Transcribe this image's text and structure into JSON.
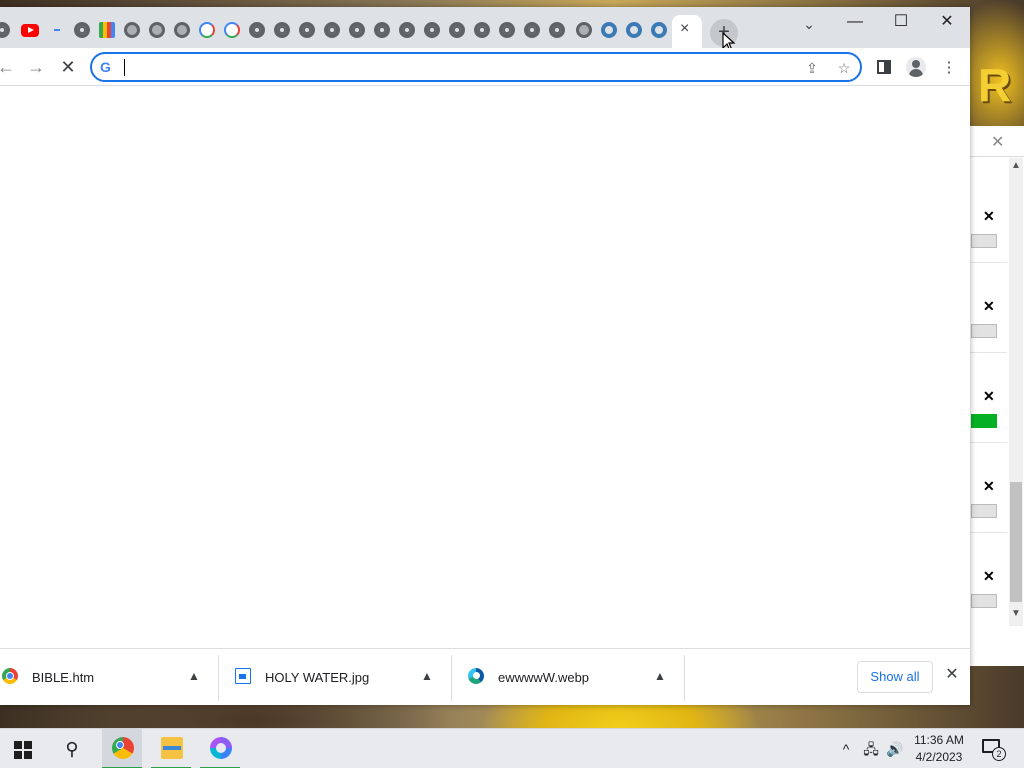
{
  "browser": {
    "new_tab_symbol": "+",
    "active_tab_close": "×",
    "window_controls": {
      "tab_search": "⌄",
      "minimize": "—",
      "maximize": "☐",
      "close": "✕"
    },
    "toolbar": {
      "back": "←",
      "forward": "→",
      "stop": "✕"
    },
    "omnibox": {
      "value": "",
      "placeholder": "",
      "search_engine_icon": "G"
    },
    "toolbar_icons": [
      "share-icon",
      "bookmark-star-icon",
      "side-panel-icon",
      "profile-icon",
      "menu-icon"
    ],
    "tab_favicons": [
      "chrome-icon",
      "youtube-icon",
      "google-dash-icon",
      "chrome-icon",
      "google-apps-grid-icon",
      "globe-icon",
      "globe-icon",
      "globe-icon",
      "google-icon",
      "google-icon",
      "chrome-icon",
      "chrome-icon",
      "chrome-icon",
      "chrome-icon",
      "chrome-icon",
      "chrome-icon",
      "chrome-icon",
      "chrome-icon",
      "chrome-icon",
      "chrome-icon",
      "chrome-icon",
      "chrome-icon",
      "globe-icon",
      "blue-ring-icon",
      "blue-ring-icon",
      "blue-ring-icon"
    ]
  },
  "downloads": {
    "items": [
      {
        "name": "BIBLE.htm",
        "icon": "chrome-file-icon"
      },
      {
        "name": "HOLY WATER.jpg",
        "icon": "image-file-icon"
      },
      {
        "name": "ewwwwW.webp",
        "icon": "edge-file-icon"
      }
    ],
    "show_all_label": "Show all",
    "close_label": "✕"
  },
  "wallpaper": {
    "letter": "R"
  },
  "taskbar": {
    "search_glyph": "⚲",
    "apps": [
      "chrome-app",
      "file-explorer-app",
      "copilot-app"
    ],
    "tray": {
      "chevron": "^",
      "network": "🖧",
      "volume": "🔊"
    },
    "time": "11:36 AM",
    "date": "4/2/2023",
    "notification_count": "2"
  },
  "colors": {
    "accent": "#1a73e8",
    "tab_strip": "#dee1e6",
    "progress_green": "#06b025"
  }
}
